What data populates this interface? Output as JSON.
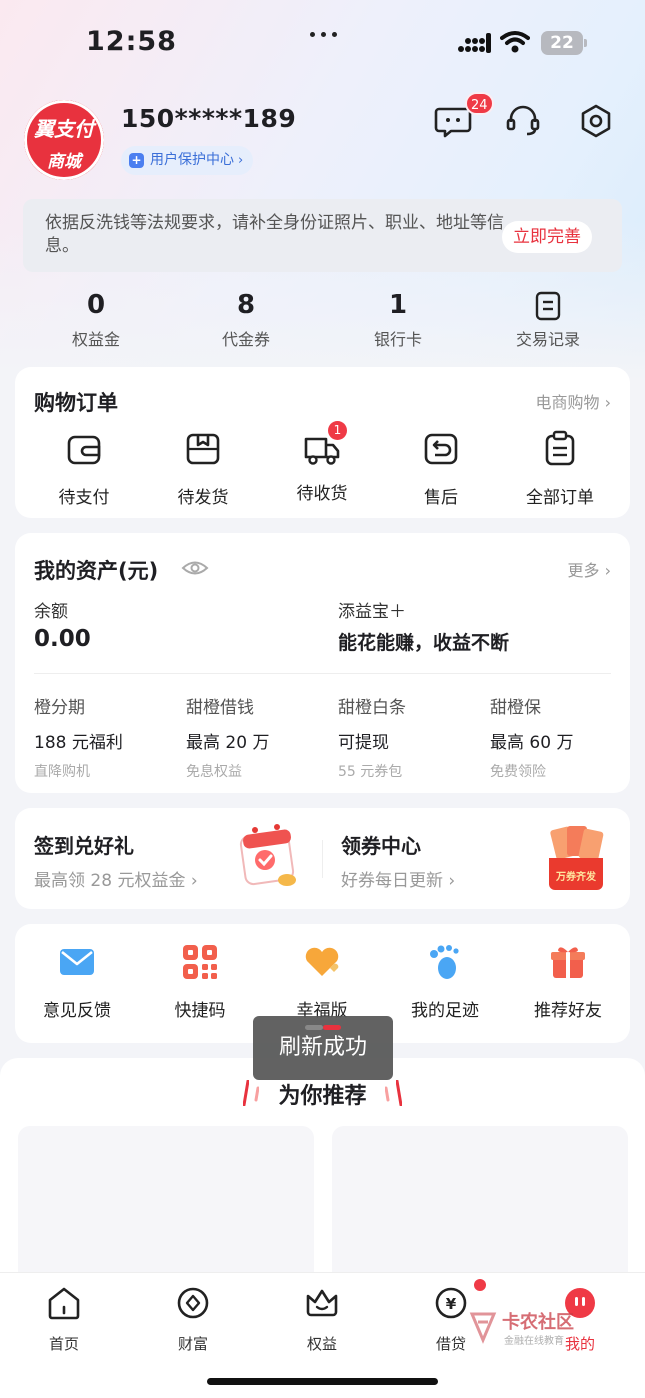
{
  "status_bar": {
    "time": "12:58",
    "battery": "22"
  },
  "profile": {
    "logo_top": "翼支付",
    "logo_bottom": "商城",
    "phone": "150*****189",
    "protect_center": "用户保护中心",
    "message_badge": "24"
  },
  "notice": {
    "text": "依据反洗钱等法规要求，请补全身份证照片、职业、地址等信息。",
    "button": "立即完善"
  },
  "stats": [
    {
      "value": "0",
      "label": "权益金"
    },
    {
      "value": "8",
      "label": "代金券"
    },
    {
      "value": "1",
      "label": "银行卡"
    },
    {
      "value": "",
      "label": "交易记录"
    }
  ],
  "orders": {
    "title": "购物订单",
    "more": "电商购物",
    "items": [
      {
        "label": "待支付",
        "icon": "wallet-icon"
      },
      {
        "label": "待发货",
        "icon": "box-icon"
      },
      {
        "label": "待收货",
        "icon": "truck-icon",
        "badge": "1"
      },
      {
        "label": "售后",
        "icon": "return-icon"
      },
      {
        "label": "全部订单",
        "icon": "clipboard-icon"
      }
    ]
  },
  "assets": {
    "title": "我的资产(元)",
    "more": "更多",
    "balance_label": "余额",
    "balance_value": "0.00",
    "tianyi_label": "添益宝＋",
    "tianyi_value": "能花能赚，收益不断",
    "products": [
      {
        "name": "橙分期",
        "value": "188 元福利",
        "sub": "直降购机"
      },
      {
        "name": "甜橙借钱",
        "value": "最高 20 万",
        "sub": "免息权益"
      },
      {
        "name": "甜橙白条",
        "value": "可提现",
        "sub": "55 元券包"
      },
      {
        "name": "甜橙保",
        "value": "最高 60 万",
        "sub": "免费领险"
      }
    ]
  },
  "promos": [
    {
      "title": "签到兑好礼",
      "sub": "最高领 28 元权益金"
    },
    {
      "title": "领券中心",
      "sub": "好券每日更新",
      "image_text": "万券齐发"
    }
  ],
  "services": [
    {
      "label": "意见反馈",
      "icon": "mail-icon"
    },
    {
      "label": "快捷码",
      "icon": "qr-code-icon"
    },
    {
      "label": "幸福版",
      "icon": "heart-icon"
    },
    {
      "label": "我的足迹",
      "icon": "footprint-icon"
    },
    {
      "label": "推荐好友",
      "icon": "gift-icon"
    }
  ],
  "recommend": {
    "title": "为你推荐"
  },
  "toast": {
    "text": "刷新成功"
  },
  "tabbar": [
    {
      "label": "首页",
      "icon": "home-icon"
    },
    {
      "label": "财富",
      "icon": "wealth-icon"
    },
    {
      "label": "权益",
      "icon": "crown-icon"
    },
    {
      "label": "借贷",
      "icon": "loan-icon"
    },
    {
      "label": "我的",
      "icon": "profile-icon"
    }
  ],
  "watermark": {
    "title": "卡农社区",
    "subtitle": "金融在线教育"
  },
  "colors": {
    "brand_red": "#e8323e",
    "badge_red": "#ef3a46",
    "protect_blue": "#3b6fd8"
  }
}
